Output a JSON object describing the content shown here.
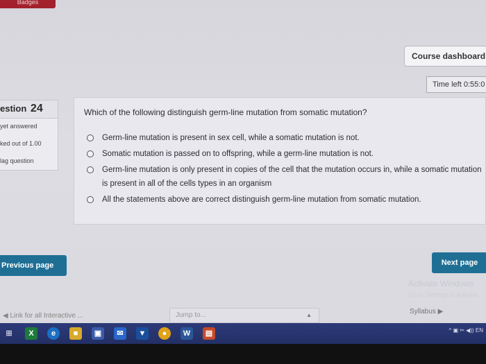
{
  "badges_tab": "Badges",
  "header": {
    "course_dashboard": "Course dashboard ❖",
    "time_left": "Time left 0:55:0"
  },
  "question_info": {
    "label": "estion",
    "number": "24",
    "status": "yet answered",
    "marks": "ked out of 1.00",
    "flag": "lag question"
  },
  "question": {
    "text": "Which of the following distinguish germ-line mutation from somatic mutation?",
    "options": [
      "Germ-line mutation is present in sex cell, while a somatic mutation is not.",
      "Somatic mutation is passed on to offspring, while a germ-line mutation is not.",
      "Germ-line mutation is only present in copies of the cell that the mutation occurs in, while a somatic mutation is present in all of the cells types in an organism",
      "All the statements above are correct distinguish germ-line mutation from somatic mutation."
    ]
  },
  "nav": {
    "previous": "Previous page",
    "next": "Next page",
    "link_interactive": "◀ Link for all Interactive ...",
    "jump_to": "Jump to...",
    "syllabus": "Syllabus ▶"
  },
  "watermark": {
    "title": "Activate Windows",
    "sub": "Go to Settings to activate"
  },
  "taskbar": {
    "tray_text": "^ ▣ ✂ ◀)) EN"
  },
  "colors": {
    "accent": "#1f6f95",
    "taskbar": "#2d3a78"
  }
}
